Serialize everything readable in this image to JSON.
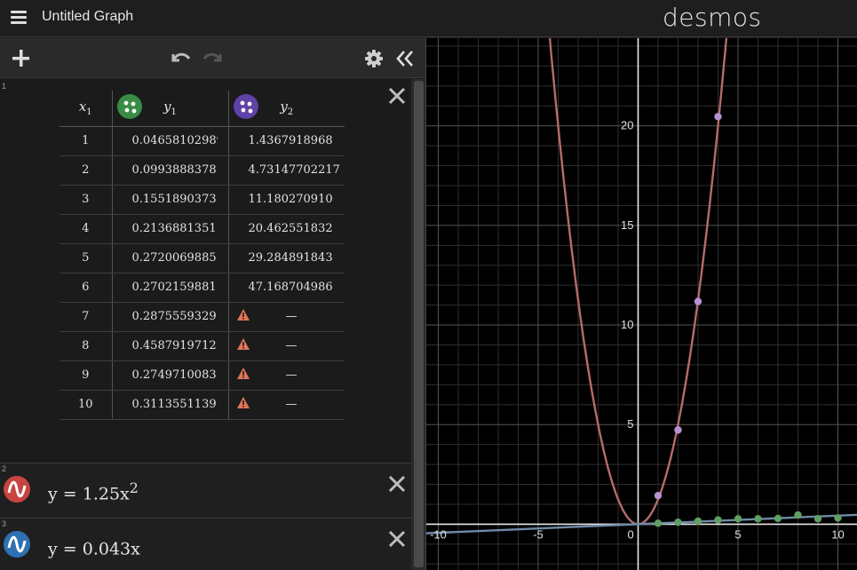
{
  "header": {
    "title": "Untitled Graph",
    "brand": "desmos"
  },
  "toolbar": {
    "add_icon": "plus-icon",
    "undo_icon": "undo-icon",
    "redo_icon": "redo-icon",
    "settings_icon": "gear-icon",
    "collapse_icon": "double-chevron-left-icon"
  },
  "table": {
    "index": "1",
    "headers": {
      "x": "x",
      "x_sub": "1",
      "y1": "y",
      "y1_sub": "1",
      "y2": "y",
      "y2_sub": "2"
    },
    "y1_color": "#388c46",
    "y2_color": "#6042a6",
    "rows": [
      {
        "x": "1",
        "y1": "0.04658102989",
        "y2": "1.4367918968"
      },
      {
        "x": "2",
        "y1": "0.0993888378",
        "y2": "4.73147702217"
      },
      {
        "x": "3",
        "y1": "0.1551890373",
        "y2": "11.180270910"
      },
      {
        "x": "4",
        "y1": "0.2136881351",
        "y2": "20.462551832"
      },
      {
        "x": "5",
        "y1": "0.2720069885",
        "y2": "29.284891843"
      },
      {
        "x": "6",
        "y1": "0.2702159881",
        "y2": "47.168704986"
      },
      {
        "x": "7",
        "y1": "0.2875559329",
        "y2": "—"
      },
      {
        "x": "8",
        "y1": "0.4587919712",
        "y2": "—"
      },
      {
        "x": "9",
        "y1": "0.2749710083",
        "y2": "—"
      },
      {
        "x": "10",
        "y1": "0.3113551139",
        "y2": "—"
      }
    ]
  },
  "expressions": [
    {
      "index": "2",
      "text": "y = 1.25x",
      "sup": "2",
      "color": "#c74440"
    },
    {
      "index": "3",
      "text": "y = 0.043x",
      "sup": "",
      "color": "#2d70b3"
    }
  ],
  "graph": {
    "x_ticks": [
      "-10",
      "-5",
      "0",
      "5",
      "10"
    ],
    "y_ticks": [
      "5",
      "10",
      "15",
      "20"
    ],
    "x_range": [
      -10.6,
      11.0
    ],
    "y_range": [
      -2.3,
      24.4
    ],
    "grid": true,
    "curve_color": "#b56b6b",
    "line_color": "#6f8ba8",
    "y1_point_color": "#5f9f62",
    "y2_point_color": "#b792d0"
  }
}
